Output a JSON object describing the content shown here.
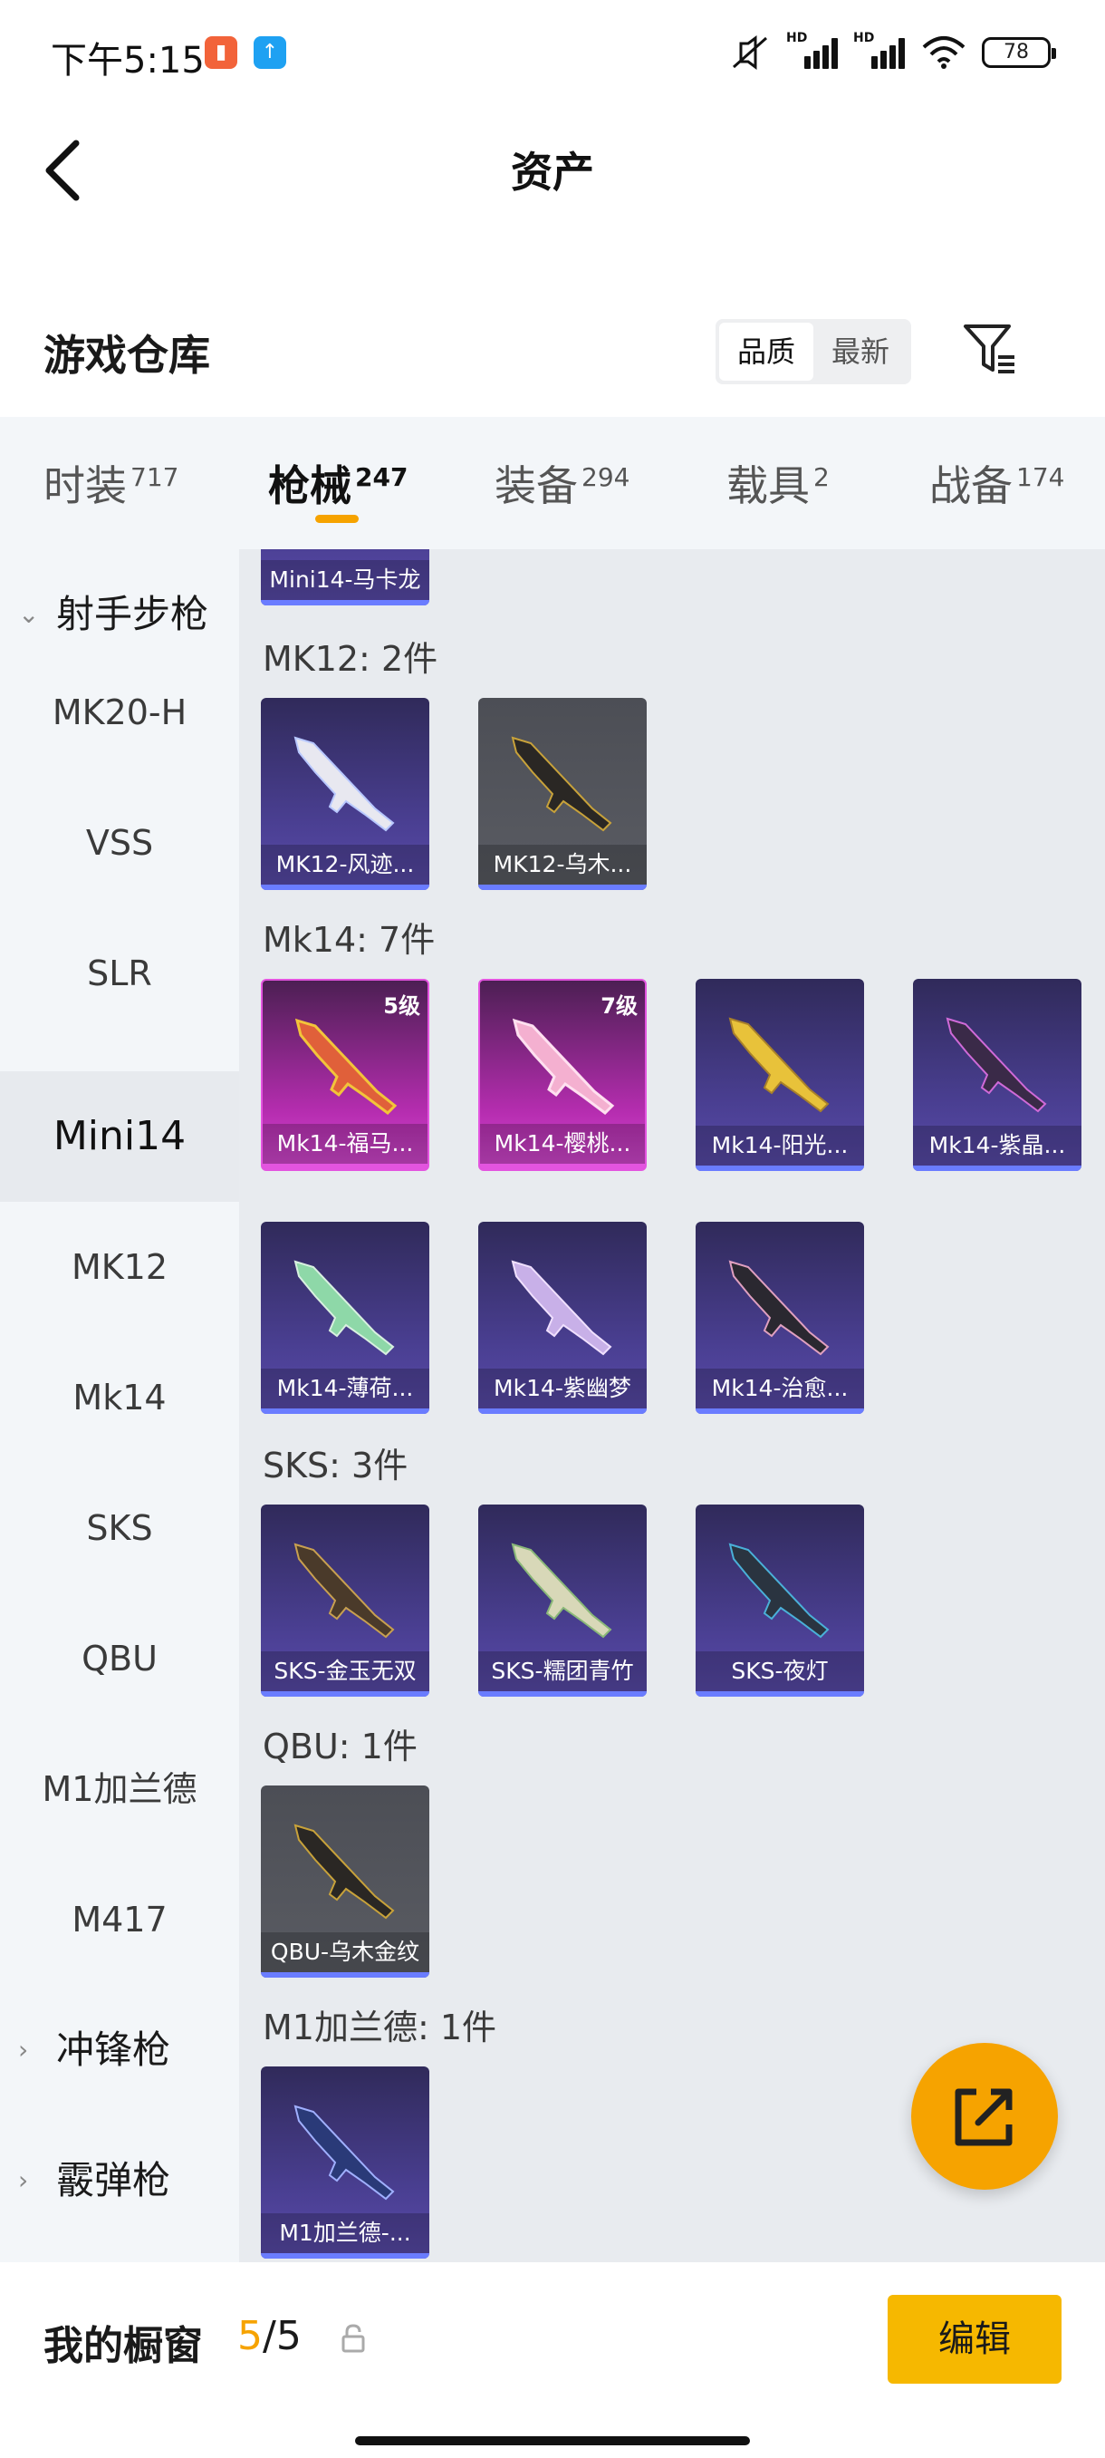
{
  "status_bar": {
    "time": "下午5:15",
    "network_1": "HD",
    "network_2": "HD",
    "battery": "78"
  },
  "header": {
    "title": "资产"
  },
  "section": {
    "title": "游戏仓库",
    "sort_options": [
      "品质",
      "最新"
    ],
    "selected_sort": "品质"
  },
  "tabs": [
    {
      "label": "时装",
      "count": "717"
    },
    {
      "label": "枪械",
      "count": "247"
    },
    {
      "label": "装备",
      "count": "294"
    },
    {
      "label": "载具",
      "count": "2"
    },
    {
      "label": "战备",
      "count": "174"
    }
  ],
  "active_tab": "枪械",
  "categories": [
    {
      "label": "射手步枪",
      "type": "group",
      "expanded": true
    },
    {
      "label": "MK20-H"
    },
    {
      "label": "VSS"
    },
    {
      "label": "SLR"
    },
    {
      "label": "Mini14",
      "selected": true
    },
    {
      "label": "MK12"
    },
    {
      "label": "Mk14"
    },
    {
      "label": "SKS"
    },
    {
      "label": "QBU"
    },
    {
      "label": "M1加兰德"
    },
    {
      "label": "M417"
    },
    {
      "label": "冲锋枪",
      "type": "group",
      "expanded": false
    },
    {
      "label": "霰弹枪",
      "type": "group",
      "expanded": false
    }
  ],
  "groups": {
    "partial_card": {
      "label": "Mini14-马卡龙"
    },
    "mk12": {
      "title": "MK12: 2件",
      "items": [
        {
          "label": "MK12-风迹...",
          "rarity": "purple"
        },
        {
          "label": "MK12-乌木...",
          "rarity": "gray"
        }
      ]
    },
    "mk14": {
      "title": "Mk14: 7件",
      "items": [
        {
          "label": "Mk14-福马...",
          "rarity": "pink",
          "level": "5级"
        },
        {
          "label": "Mk14-樱桃...",
          "rarity": "pink",
          "level": "7级"
        },
        {
          "label": "Mk14-阳光...",
          "rarity": "purple"
        },
        {
          "label": "Mk14-紫晶...",
          "rarity": "purple"
        },
        {
          "label": "Mk14-薄荷...",
          "rarity": "purple"
        },
        {
          "label": "Mk14-紫幽梦",
          "rarity": "purple"
        },
        {
          "label": "Mk14-治愈...",
          "rarity": "purple"
        }
      ]
    },
    "sks": {
      "title": "SKS: 3件",
      "items": [
        {
          "label": "SKS-金玉无双",
          "rarity": "purple"
        },
        {
          "label": "SKS-糯团青竹",
          "rarity": "purple"
        },
        {
          "label": "SKS-夜灯",
          "rarity": "purple"
        }
      ]
    },
    "qbu": {
      "title": "QBU: 1件",
      "items": [
        {
          "label": "QBU-乌木金纹",
          "rarity": "gray"
        }
      ]
    },
    "m1": {
      "title": "M1加兰德: 1件",
      "items": [
        {
          "label": "M1加兰德-...",
          "rarity": "purple"
        }
      ]
    }
  },
  "bottom_bar": {
    "label": "我的橱窗",
    "current": "5",
    "total": "/5",
    "edit_label": "编辑"
  },
  "colors": {
    "accent": "#f6a300",
    "button": "#f6b800",
    "rarity_purple": "#4a3f92",
    "rarity_pink": "#b62db0",
    "rarity_gray": "#55575e"
  },
  "icons": [
    "back-icon",
    "filter-icon",
    "share-icon",
    "lock-icon",
    "mute-icon",
    "wifi-icon"
  ]
}
